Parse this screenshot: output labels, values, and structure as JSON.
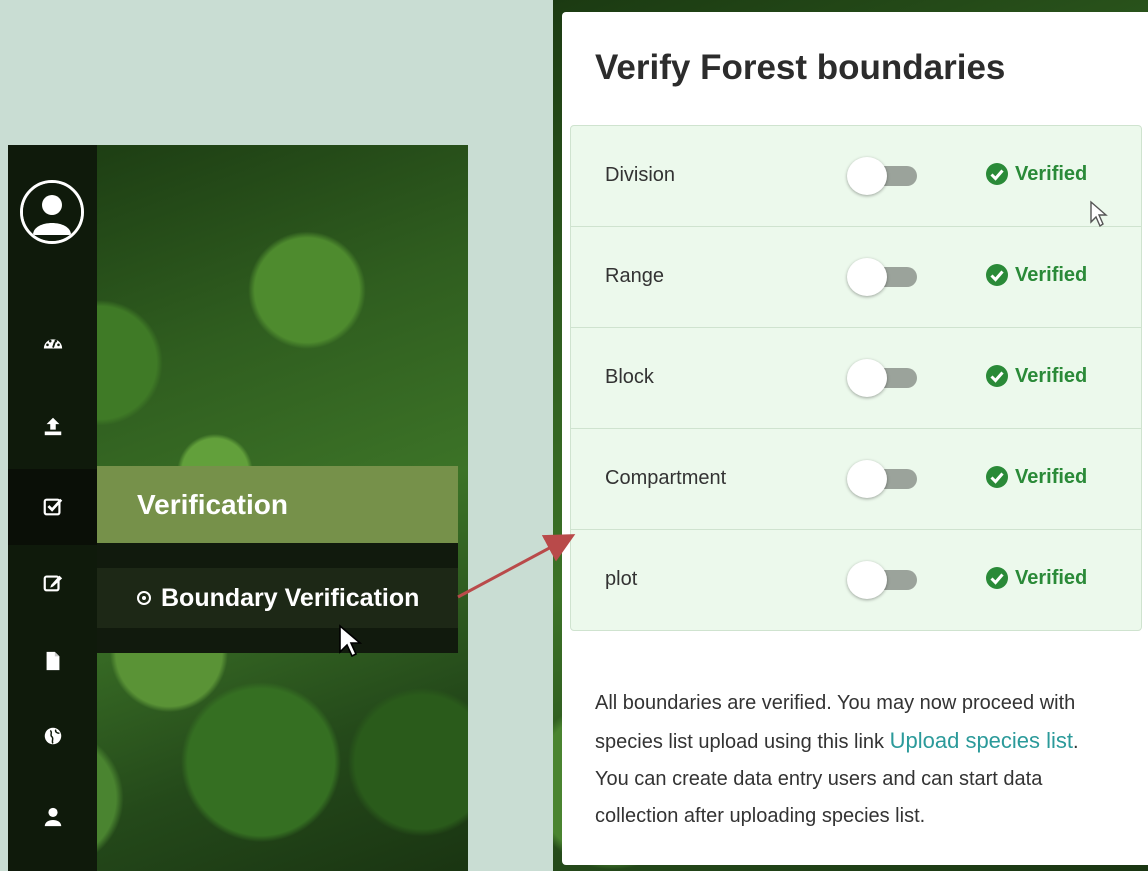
{
  "sidebar": {
    "icons": [
      "user-avatar-icon",
      "dashboard-icon",
      "upload-icon",
      "verification-check-icon",
      "edit-icon",
      "document-icon",
      "globe-icon",
      "user-icon"
    ]
  },
  "menu": {
    "title": "Verification",
    "submenu_item": "Boundary Verification"
  },
  "panel": {
    "title": "Verify Forest boundaries",
    "rows": [
      {
        "label": "Division",
        "status": "Verified"
      },
      {
        "label": "Range",
        "status": "Verified"
      },
      {
        "label": "Block",
        "status": "Verified"
      },
      {
        "label": "Compartment",
        "status": "Verified"
      },
      {
        "label": "plot",
        "status": "Verified"
      }
    ],
    "message": {
      "before_link": "All boundaries are verified. You may now proceed with species list upload using this link ",
      "link": "Upload species list",
      "after_link": ". You can create data entry users and can start data collection after uploading species list."
    }
  },
  "colors": {
    "menu_active": "#76914a",
    "verified": "#2a8a38",
    "link": "#2b9a9a",
    "arrow": "#b94a4a"
  }
}
